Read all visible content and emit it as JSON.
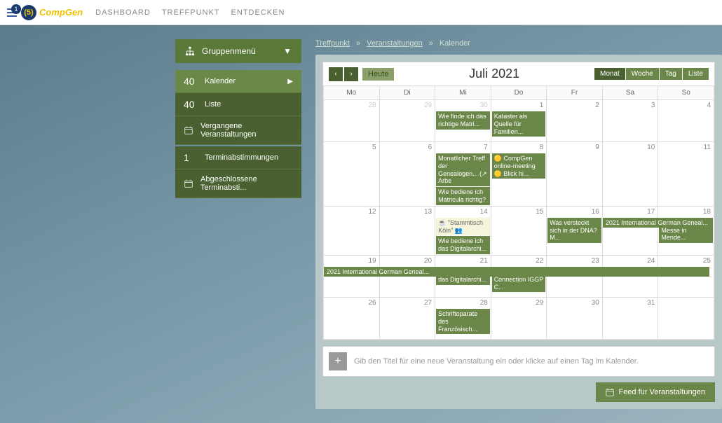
{
  "topbar": {
    "badge": "1",
    "logo": "CompGen",
    "nav": [
      "DASHBOARD",
      "TREFFPUNKT",
      "ENTDECKEN"
    ]
  },
  "sidebar": {
    "groupMenu": "Gruppenmenü",
    "section1": [
      {
        "count": "40",
        "label": "Kalender",
        "hasArrow": true,
        "active": true
      },
      {
        "count": "40",
        "label": "Liste"
      },
      {
        "icon": "calendar",
        "label": "Vergangene Veranstaltungen"
      }
    ],
    "section2": [
      {
        "count": "1",
        "label": "Terminabstimmungen"
      },
      {
        "icon": "calendar-check",
        "label": "Abgeschlossene Terminabsti..."
      }
    ]
  },
  "breadcrumb": {
    "items": [
      "Treffpunkt",
      "Veranstaltungen",
      "Kalender"
    ]
  },
  "calendar": {
    "title": "Juli 2021",
    "heute": "Heute",
    "views": [
      "Monat",
      "Woche",
      "Tag",
      "Liste"
    ],
    "activeView": "Monat",
    "daysOfWeek": [
      "Mo",
      "Di",
      "Mi",
      "Do",
      "Fr",
      "Sa",
      "So"
    ],
    "weeks": [
      {
        "days": [
          {
            "num": "28",
            "other": true
          },
          {
            "num": "29",
            "other": true
          },
          {
            "num": "30",
            "other": true,
            "events": [
              {
                "t": "Wie finde ich das richtige Matri..."
              }
            ]
          },
          {
            "num": "1",
            "events": [
              {
                "t": "Kataster als Quelle für Familien..."
              }
            ]
          },
          {
            "num": "2"
          },
          {
            "num": "3"
          },
          {
            "num": "4"
          }
        ]
      },
      {
        "days": [
          {
            "num": "5"
          },
          {
            "num": "6"
          },
          {
            "num": "7",
            "events": [
              {
                "t": "Monatlicher Treff der Genealogen... (↗ Arbe"
              },
              {
                "t": "Wie bediene ich Matricula richtig?"
              }
            ]
          },
          {
            "num": "8",
            "events": [
              {
                "t": "🟡 CompGen online-meeting 🟡 Blick hi..."
              }
            ]
          },
          {
            "num": "9"
          },
          {
            "num": "10"
          },
          {
            "num": "11"
          }
        ]
      },
      {
        "days": [
          {
            "num": "12"
          },
          {
            "num": "13"
          },
          {
            "num": "14",
            "events": [
              {
                "t": "☕ \"Stammtisch Köln\" 👥",
                "hl": true
              },
              {
                "t": "Wie bediene ich das Digitalarchi..."
              }
            ]
          },
          {
            "num": "15"
          },
          {
            "num": "16",
            "events": [
              {
                "t": "Was versteckt sich in der DNA? M..."
              }
            ]
          },
          {
            "num": "17",
            "span": {
              "t": "2021 International German Geneal..."
            }
          },
          {
            "num": "18",
            "events": [
              {
                "t": "6. genealogische Messe in Mende..."
              }
            ]
          }
        ]
      },
      {
        "spanFull": {
          "t": "2021 International German Geneal..."
        },
        "days": [
          {
            "num": "19"
          },
          {
            "num": "20"
          },
          {
            "num": "21",
            "events": [
              {
                "t": "Wie bediene ich das Digitalarchi..."
              }
            ]
          },
          {
            "num": "22",
            "events": [
              {
                "t": "Hessian Online Connection IGGP C..."
              }
            ]
          },
          {
            "num": "23"
          },
          {
            "num": "24"
          },
          {
            "num": "25"
          }
        ]
      },
      {
        "days": [
          {
            "num": "26"
          },
          {
            "num": "27"
          },
          {
            "num": "28",
            "events": [
              {
                "t": "Schriftoparate des Französisch..."
              }
            ]
          },
          {
            "num": "29"
          },
          {
            "num": "30"
          },
          {
            "num": "31"
          },
          {
            "num": ""
          }
        ]
      }
    ]
  },
  "addBar": {
    "text": "Gib den Titel für eine neue Veranstaltung ein oder klicke auf einen Tag im Kalender."
  },
  "feedBtn": "Feed für Veranstaltungen"
}
